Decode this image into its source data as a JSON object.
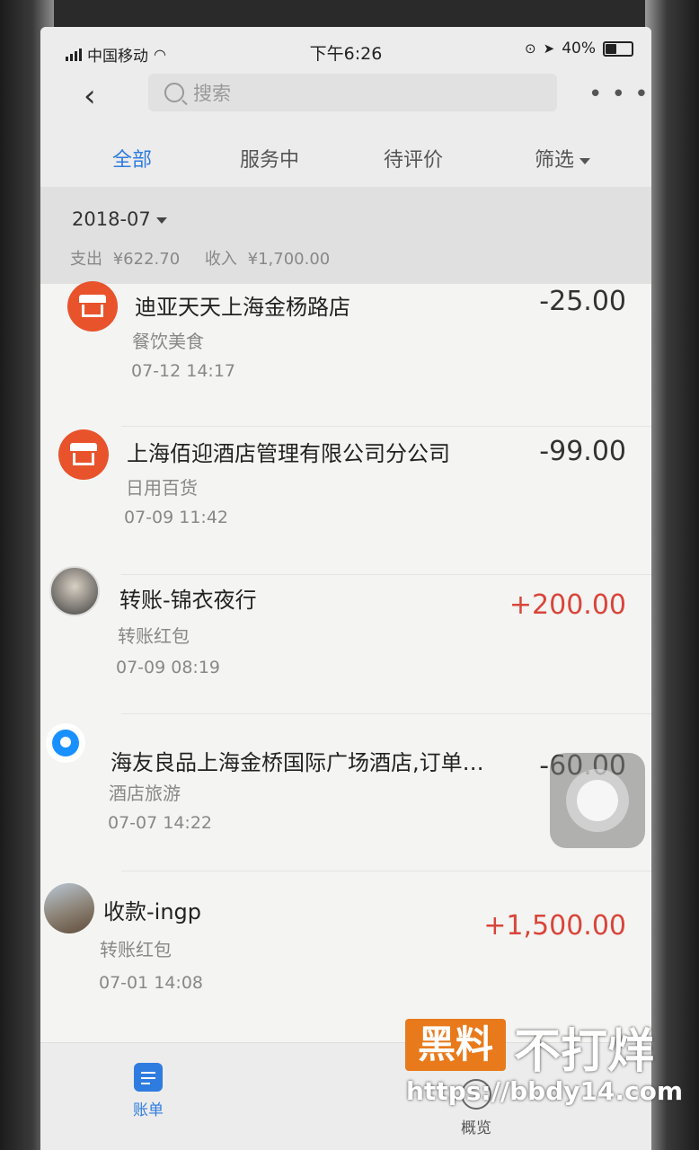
{
  "status": {
    "carrier": "中国移动",
    "time": "下午6:26",
    "battery": "40%"
  },
  "nav": {
    "search_placeholder": "搜索"
  },
  "tabs": [
    {
      "label": "全部",
      "active": true
    },
    {
      "label": "服务中",
      "active": false
    },
    {
      "label": "待评价",
      "active": false
    },
    {
      "label": "筛选",
      "active": false
    }
  ],
  "month": {
    "label": "2018-07",
    "expense_label": "支出",
    "expense": "¥622.70",
    "income_label": "收入",
    "income": "¥1,700.00"
  },
  "transactions": [
    {
      "name": "迪亚天天上海金杨路店",
      "category": "餐饮美食",
      "date": "07-12  14:17",
      "amount": "-25.00",
      "icon": "store-icon",
      "type": "expense"
    },
    {
      "name": "上海佰迎酒店管理有限公司分公司",
      "category": "日用百货",
      "date": "07-09  11:42",
      "amount": "-99.00",
      "icon": "store-icon",
      "type": "expense"
    },
    {
      "name": "转账-锦衣夜行",
      "category": "转账红包",
      "date": "07-09  08:19",
      "amount": "+200.00",
      "icon": "avatar",
      "type": "income"
    },
    {
      "name": "海友良品上海金桥国际广场酒店,订单…",
      "category": "酒店旅游",
      "date": "07-07  14:22",
      "amount": "-60.00",
      "icon": "p-brand-icon",
      "type": "expense"
    },
    {
      "name": "收款-ingp",
      "category": "转账红包",
      "date": "07-01  14:08",
      "amount": "+1,500.00",
      "icon": "photo-avatar",
      "type": "income"
    }
  ],
  "bottom_tabs": [
    {
      "label": "账单",
      "icon": "bill-icon",
      "active": true
    },
    {
      "label": "概览",
      "icon": "overview-icon",
      "active": false
    }
  ],
  "watermark": {
    "brand": "黑料",
    "text": "不打烊",
    "url": "https://bbdy14.com"
  },
  "colors": {
    "accent": "#2f7ce0",
    "income": "#d9453a",
    "store_icon": "#e8532c"
  }
}
